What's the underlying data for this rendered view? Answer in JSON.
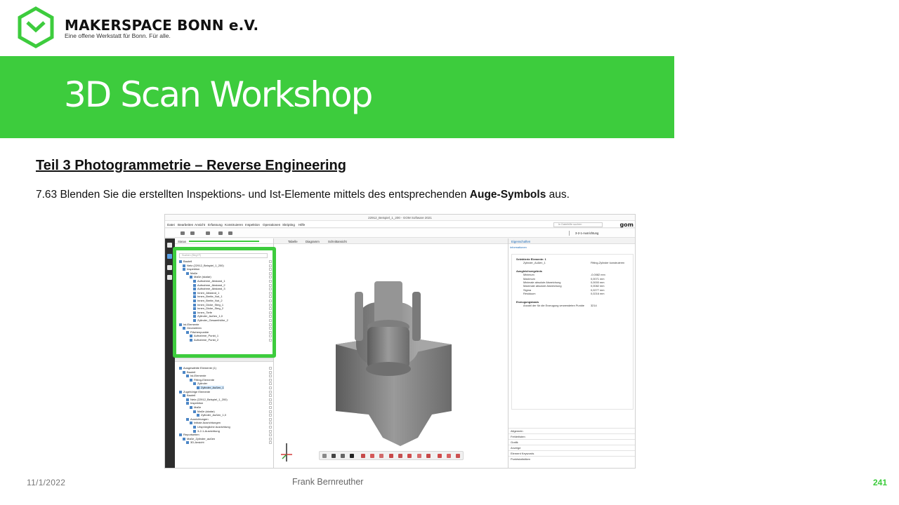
{
  "header": {
    "brand_title": "MAKERSPACE BONN e.V.",
    "brand_subtitle": "Eine offene Werkstatt für Bonn. Für alle.",
    "banner_title": "3D Scan Workshop"
  },
  "content": {
    "section_title": "Teil 3  Photogrammetrie  – Reverse Engineering",
    "instruction_prefix": "7.63 Blenden Sie die erstellten Inspektions- und Ist-Elemente mittels des entsprechenden ",
    "instruction_bold": "Auge-Symbols",
    "instruction_suffix": " aus."
  },
  "app": {
    "window_title": "22912_Beispiel_1_200 - GOM Software 2021",
    "menu": [
      "Datei",
      "Bearbeiten",
      "Ansicht",
      "Erfassung",
      "Konstruieren",
      "Inspektion",
      "Operationen",
      "Skripting",
      "Hilfe"
    ],
    "search_placeholder": "In Dateihilfe suchen",
    "logo_text": "gom",
    "alignment": "3-2-1-Ausrichtung",
    "status_label": "Status",
    "tree_search_placeholder": "Suchen (Strg+F)",
    "tree_top": [
      "Bauteil",
      "Netz (22912_Beispiel_1_200)",
      "Inspektion",
      "Maße",
      "Maße (skalar)",
      "Aufnahme_Abstand_1",
      "Aufnahme_Abstand_2",
      "Aufnahme_Abstand_3",
      "Innen_Abstand_1",
      "Innen_Breite_Nut_1",
      "Innen_Breite_Nut_2",
      "Innen_Dicke_Steg_1",
      "Innen_Dicke_Steg_2",
      "Innen_Tiefe",
      "Zylinder_Außen_1,0",
      "Zylinder_Gesamthöhe_2",
      "Ist-Elemente",
      "Geometrien",
      "Flächenpunkte",
      "Aufnahme_Punkt_1",
      "Aufnahme_Punkt_2"
    ],
    "tree_bottom": [
      "Ausgewählte Elemente (1)",
      "Bauteil",
      "Ist-Elemente",
      "Fitting-Elemente",
      "Zylinder",
      "Zylinder_Außen_1",
      "Zugehörige Elemente",
      "Bauteil",
      "Netz (22912_Beispiel_1_200)",
      "Inspektion",
      "Maße",
      "Maße (skalar)",
      "Zylinder_Außen_1,0",
      "Ausrichtungen",
      "Initiale Ausrichtungen",
      "Ursprüngliche Ausrichtung",
      "3-2-1-Ausrichtung",
      "Reportseiten",
      "Maße_Zylinder_außen",
      "3D-Ansicht"
    ],
    "viewport_tabs": [
      "Tabelle",
      "Diagramm",
      "Schnittansicht"
    ],
    "props_tabs": [
      "Eigenschaften",
      "Informationen"
    ],
    "props": [
      {
        "label": "Selektierte Elemente: 1",
        "value": "",
        "head": true
      },
      {
        "label": "Zylinder_Außen_1",
        "value": "Fitting-Zylinder konstruieren",
        "head": false
      },
      {
        "label": "Ausgleichsergebnis",
        "value": "",
        "head": true
      },
      {
        "label": "Minimum",
        "value": "-0,0082 mm",
        "head": false
      },
      {
        "label": "Maximum",
        "value": "0,0071 mm",
        "head": false
      },
      {
        "label": "Minimale absolute Abweichung",
        "value": "0,0000 mm",
        "head": false
      },
      {
        "label": "Maximale absolute Abweichung",
        "value": "0,0082 mm",
        "head": false
      },
      {
        "label": "Sigma",
        "value": "0,0277 mm",
        "head": false
      },
      {
        "label": "Residuum",
        "value": "0,0216 mm",
        "head": false
      },
      {
        "label": "Erzeugungsbasis",
        "value": "",
        "head": true
      },
      {
        "label": "Anzahl der für die Erzeugung verwendeten Punkte",
        "value": "3214",
        "head": false
      }
    ],
    "props_sections": [
      "Allgemein",
      "Fehlerlisten",
      "Grafik",
      "Anzeige",
      "Element Keywords",
      "Punktstatistiken"
    ]
  },
  "footer": {
    "date": "11/1/2022",
    "author": "Frank Bernreuther",
    "page": "241"
  },
  "colors": {
    "accent_green": "#3dcc3d"
  }
}
